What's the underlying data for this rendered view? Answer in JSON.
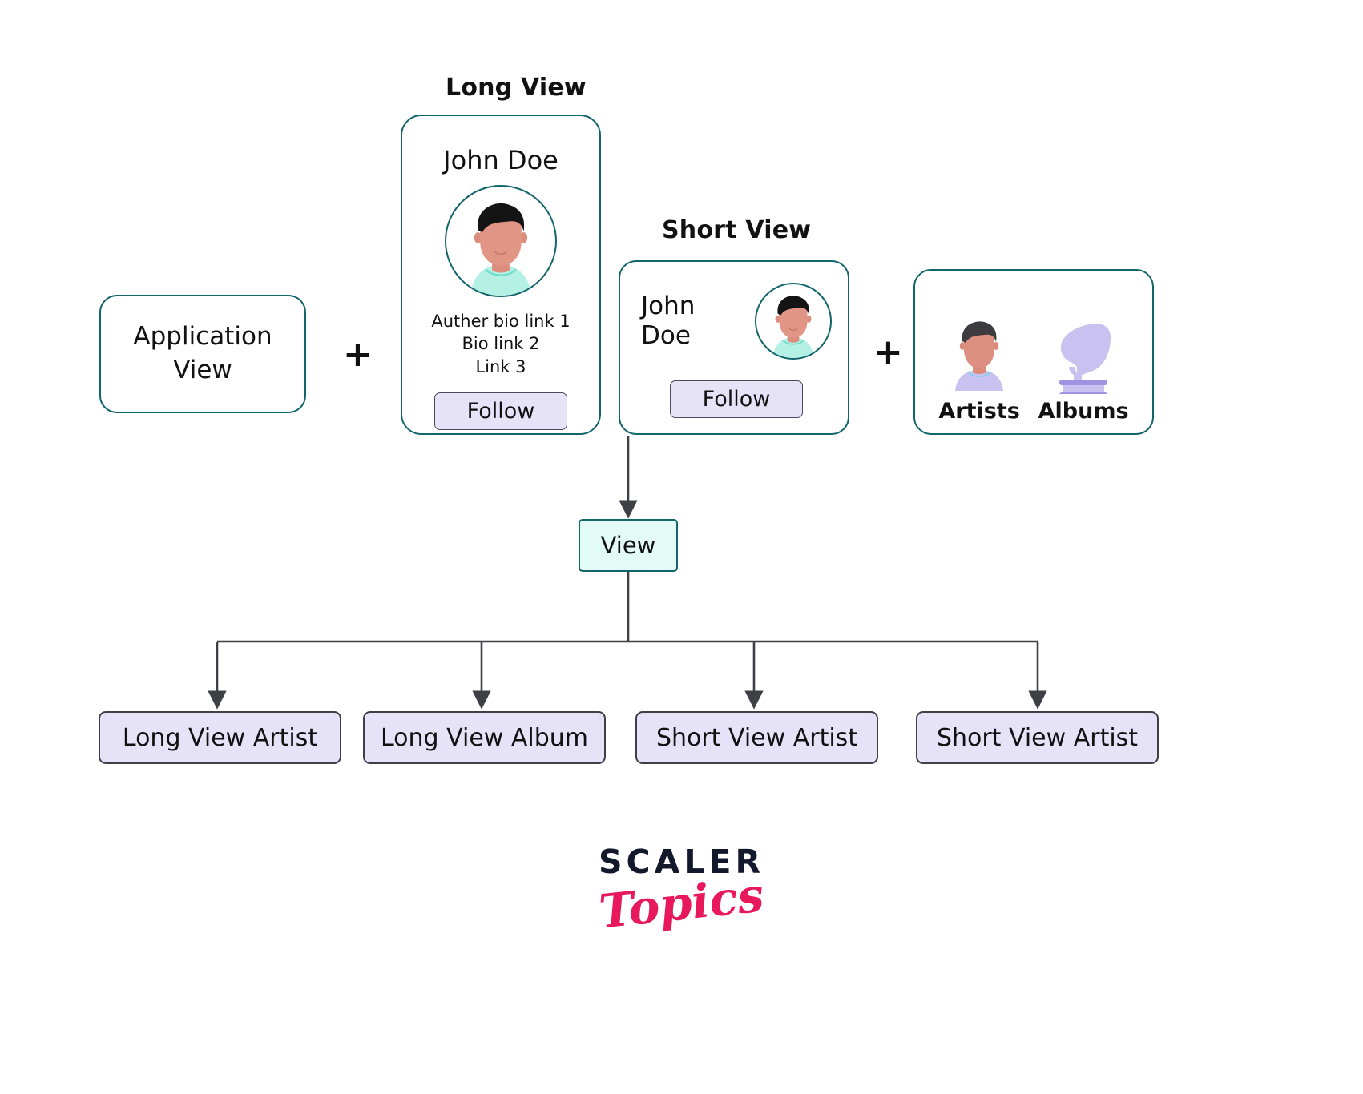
{
  "colors": {
    "card_border_teal": "#12656b",
    "button_purple": "#e6e3f8",
    "view_node_fill": "#e2fbf6",
    "logo_dark": "#14182c",
    "logo_pink": "#e8185c",
    "avatar_skin": "#e09080",
    "avatar_hair": "#141414",
    "avatar_shirt_mint": "#b4f0e3",
    "avatar_shirt_lavender": "#c9c2f0",
    "gramophone_purple": "#c9c2f0",
    "arrow_stroke": "#3f3f46"
  },
  "captions": {
    "long_view": "Long View",
    "short_view": "Short View"
  },
  "application_view": {
    "label_line1": "Application",
    "label_line2": "View"
  },
  "operators": {
    "plus_1": "+",
    "plus_2": "+"
  },
  "long_view_card": {
    "person_name": "John Doe",
    "avatar_name": "avatar-john-doe-large",
    "bio_line_1": "Auther bio link 1",
    "bio_line_2": "Bio link 2",
    "bio_line_3": "Link 3",
    "follow_label": "Follow"
  },
  "short_view_card": {
    "person_name_line1": "John",
    "person_name_line2": "Doe",
    "avatar_name": "avatar-john-doe-small",
    "follow_label": "Follow"
  },
  "artists_albums_card": {
    "items": [
      {
        "label": "Artists",
        "icon": "person-avatar-icon"
      },
      {
        "label": "Albums",
        "icon": "gramophone-icon"
      }
    ]
  },
  "view_node": {
    "label": "View"
  },
  "results": [
    {
      "label": "Long View Artist"
    },
    {
      "label": "Long View Album"
    },
    {
      "label": "Short View Artist"
    },
    {
      "label": "Short View Artist"
    }
  ],
  "logo": {
    "primary": "SCALER",
    "secondary": "Topics"
  }
}
